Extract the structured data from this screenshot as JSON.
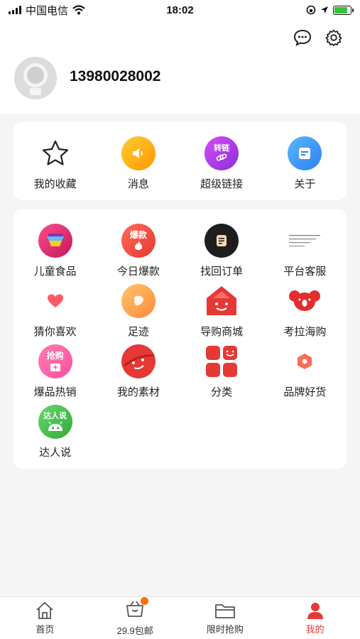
{
  "status_bar": {
    "carrier": "中国电信",
    "time": "18:02",
    "battery_color": "#36c23a"
  },
  "profile": {
    "phone": "13980028002",
    "avatar_icon": "default-avatar-icon",
    "message_icon": "chat-bubble-icon",
    "settings_icon": "gear-icon"
  },
  "quick_actions": [
    {
      "label": "我的收藏",
      "icon": "star-icon"
    },
    {
      "label": "消息",
      "icon": "speaker-icon"
    },
    {
      "label": "超级链接",
      "icon": "link-icon",
      "badge_text": "转链"
    },
    {
      "label": "关于",
      "icon": "info-doc-icon"
    }
  ],
  "services": [
    {
      "label": "儿童食品",
      "icon": "kids-food-icon"
    },
    {
      "label": "今日爆款",
      "icon": "hot-item-icon",
      "badge_text": "爆款"
    },
    {
      "label": "找回订单",
      "icon": "order-icon"
    },
    {
      "label": "平台客服",
      "icon": "customer-service-icon"
    },
    {
      "label": "猜你喜欢",
      "icon": "heart-icon"
    },
    {
      "label": "足迹",
      "icon": "footprint-icon"
    },
    {
      "label": "导购商城",
      "icon": "mall-icon"
    },
    {
      "label": "考拉海购",
      "icon": "koala-icon"
    },
    {
      "label": "爆品热销",
      "icon": "flash-sale-icon",
      "badge_text": "抢购"
    },
    {
      "label": "我的素材",
      "icon": "planet-icon"
    },
    {
      "label": "分类",
      "icon": "category-icon"
    },
    {
      "label": "品牌好货",
      "icon": "brand-icon"
    },
    {
      "label": "达人说",
      "icon": "talent-icon",
      "badge_text": "达人说"
    }
  ],
  "tabs": [
    {
      "label": "首页",
      "icon": "home-icon"
    },
    {
      "label": "29.9包邮",
      "icon": "shopping-basket-icon"
    },
    {
      "label": "限时抢购",
      "icon": "folder-icon"
    },
    {
      "label": "我的",
      "icon": "user-icon",
      "active": true
    }
  ],
  "colors": {
    "accent": "#e53935",
    "background": "#f5f5f5"
  }
}
